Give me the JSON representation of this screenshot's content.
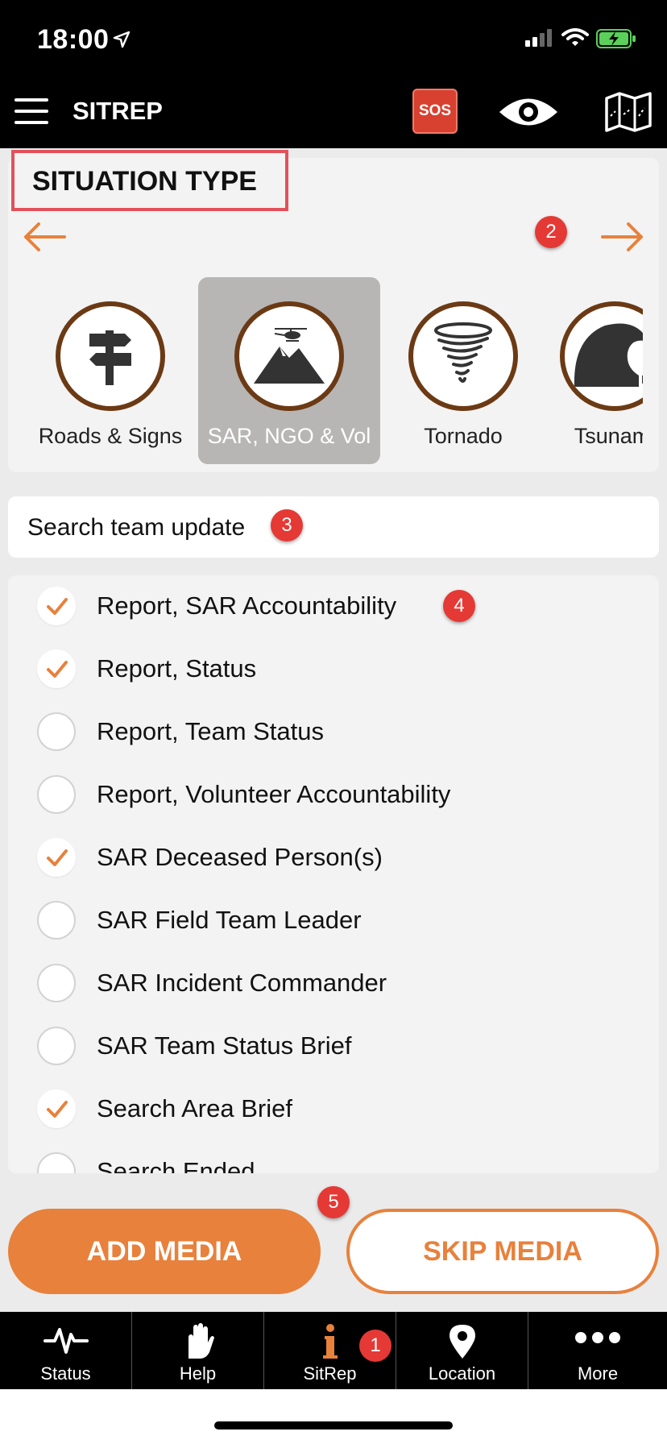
{
  "status_bar": {
    "time": "18:00"
  },
  "nav": {
    "title": "SITREP",
    "sos_label": "SOS"
  },
  "situation": {
    "heading": "SITUATION TYPE",
    "categories": [
      {
        "label": "Roads & Signs",
        "icon": "signpost-icon",
        "selected": false
      },
      {
        "label": "SAR, NGO & Vol",
        "icon": "mountain-helicopter-icon",
        "selected": true
      },
      {
        "label": "Tornado",
        "icon": "tornado-icon",
        "selected": false
      },
      {
        "label": "Tsunami",
        "icon": "tsunami-wave-icon",
        "selected": false
      }
    ]
  },
  "search": {
    "value": "Search team update"
  },
  "items": [
    {
      "label": "Report, SAR Accountability",
      "checked": true
    },
    {
      "label": "Report, Status",
      "checked": true
    },
    {
      "label": "Report, Team Status",
      "checked": false
    },
    {
      "label": "Report, Volunteer Accountability",
      "checked": false
    },
    {
      "label": "SAR Deceased Person(s)",
      "checked": true
    },
    {
      "label": "SAR Field Team Leader",
      "checked": false
    },
    {
      "label": "SAR Incident Commander",
      "checked": false
    },
    {
      "label": "SAR Team Status Brief",
      "checked": false
    },
    {
      "label": "Search Area Brief",
      "checked": true
    },
    {
      "label": "Search Ended",
      "checked": false
    }
  ],
  "buttons": {
    "add_media": "ADD MEDIA",
    "skip_media": "SKIP MEDIA"
  },
  "tabs": [
    {
      "label": "Status",
      "icon": "pulse-icon"
    },
    {
      "label": "Help",
      "icon": "hand-icon"
    },
    {
      "label": "SitRep",
      "icon": "info-icon"
    },
    {
      "label": "Location",
      "icon": "location-pin-icon"
    },
    {
      "label": "More",
      "icon": "more-dots-icon"
    }
  ],
  "badges": {
    "b1": "1",
    "b2": "2",
    "b3": "3",
    "b4": "4",
    "b5": "5"
  },
  "colors": {
    "accent": "#e8813c",
    "badge": "#e53935",
    "brown": "#6b3a14",
    "highlight": "#e1515b"
  }
}
